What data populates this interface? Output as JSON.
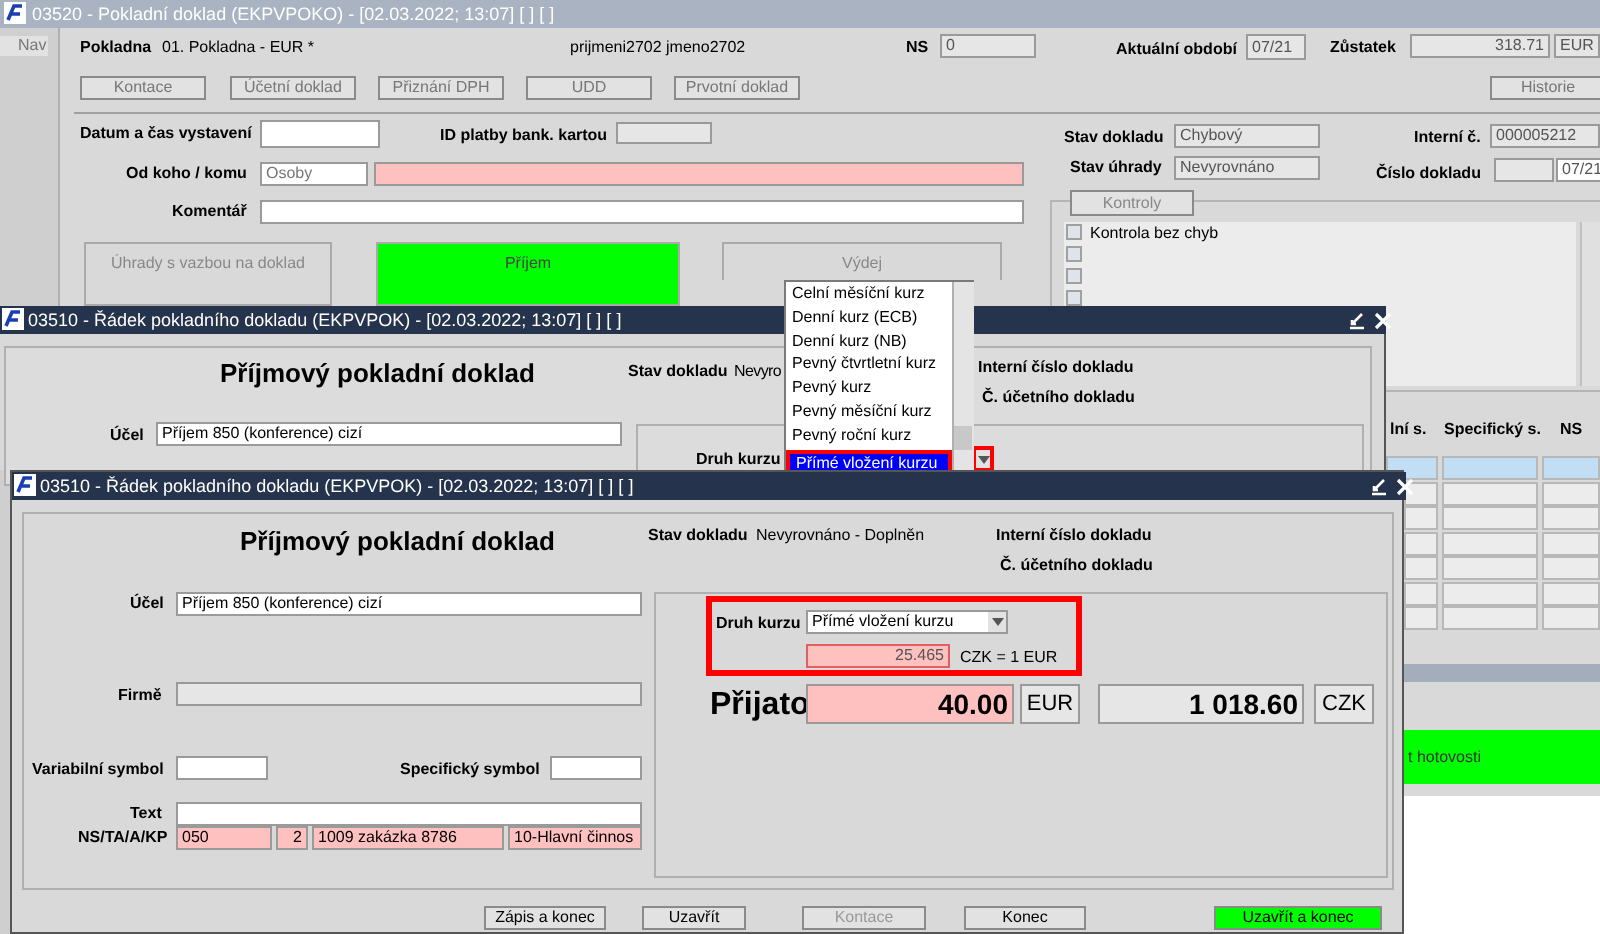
{
  "main_window": {
    "title": "03520 - Pokladní doklad (EKPVPOKO) - [02.03.2022; 13:07] [ ] [ ]",
    "nav": "Nav",
    "cash_desk_label": "Pokladna",
    "cash_desk_value": "01. Pokladna - EUR *",
    "user": "prijmeni2702 jmeno2702",
    "ns_label": "NS",
    "ns_value": "0",
    "period_label": "Aktuální období",
    "period_value": "07/21",
    "balance_label": "Zůstatek",
    "balance_value": "318.71",
    "balance_currency": "EUR",
    "buttons": [
      "Kontace",
      "Účetní doklad",
      "Přiznání DPH",
      "UDD",
      "Prvotní doklad"
    ],
    "history_button": "Historie",
    "issued_label": "Datum a čas vystavení",
    "card_id_label": "ID platby bank. kartou",
    "doc_state_label": "Stav dokladu",
    "doc_state_value": "Chybový",
    "internal_label": "Interní č.",
    "internal_value": "000005212",
    "from_to_label": "Od koho / komu",
    "from_to_type": "Osoby",
    "payment_state_label": "Stav úhrady",
    "payment_state_value": "Nevyrovnáno",
    "doc_number_label": "Číslo dokladu",
    "doc_number_period": "07/21",
    "comment_label": "Komentář",
    "checks_tab": "Kontroly",
    "checks": [
      {
        "label": "Kontrola bez chyb",
        "checked": false
      },
      {
        "checked": false
      },
      {
        "checked": false
      },
      {
        "checked": false
      }
    ],
    "actions": [
      {
        "label": "Úhrady s vazbou na doklad",
        "kind": "plain"
      },
      {
        "label": "Příjem",
        "kind": "green"
      },
      {
        "label": "Výdej",
        "kind": "plain"
      }
    ],
    "table": {
      "columns": [
        "lní s.",
        "Specifický s.",
        "NS"
      ]
    },
    "cash_button": "t hotovosti"
  },
  "middle_window": {
    "title": "03510 - Řádek pokladního dokladu (EKPVPOK) - [02.03.2022; 13:07] [ ] [ ]",
    "heading": "Příjmový pokladní doklad",
    "state_label": "Stav dokladu",
    "state_value": "Nevyro",
    "internal_label": "Interní číslo dokladu",
    "accounting_label": "Č. účetního dokladu",
    "purpose_label": "Účel",
    "purpose_value": "Příjem 850 (konference) cizí",
    "rate_label": "Druh kurzu"
  },
  "rate_dropdown": {
    "items": [
      {
        "label": "Celní měsíční kurz",
        "selected": false
      },
      {
        "label": "Denní kurz (ECB)",
        "selected": false
      },
      {
        "label": "Denní kurz (NB)",
        "selected": false
      },
      {
        "label": "Pevný čtvrtletní kurz",
        "selected": false
      },
      {
        "label": "Pevný kurz",
        "selected": false
      },
      {
        "label": "Pevný měsíční kurz",
        "selected": false
      },
      {
        "label": "Pevný roční kurz",
        "selected": false
      },
      {
        "label": "Přímé vložení kurzu",
        "selected": true
      }
    ]
  },
  "front_window": {
    "title": "03510 - Řádek pokladního dokladu (EKPVPOK) - [02.03.2022; 13:07] [ ] [ ]",
    "heading": "Příjmový pokladní doklad",
    "state_label": "Stav dokladu",
    "state_value": "Nevyrovnáno - Doplněn",
    "internal_label": "Interní číslo dokladu",
    "accounting_label": "Č. účetního dokladu",
    "purpose_label": "Účel",
    "purpose_value": "Příjem 850 (konference) cizí",
    "company_label": "Firmě",
    "variable_label": "Variabilní symbol",
    "specific_label": "Specifický symbol",
    "text_label": "Text",
    "codes_label": "NS/TA/A/KP",
    "codes": [
      "050",
      "2",
      "1009 zakázka 8786",
      "10-Hlavní činnos"
    ],
    "rate_label": "Druh kurzu",
    "rate_value": "Přímé vložení kurzu",
    "rate": "25.465",
    "rate_unit": "CZK = 1 EUR",
    "received_label": "Přijato",
    "amount": "40.00",
    "amount_currency": "EUR",
    "converted": "1 018.60",
    "converted_currency": "CZK",
    "buttons": [
      {
        "label": "Zápis a konec",
        "kind": "normal"
      },
      {
        "label": "Uzavřít",
        "kind": "normal"
      },
      {
        "label": "Kontace",
        "kind": "disabled"
      },
      {
        "label": "Konec",
        "kind": "normal"
      },
      {
        "label": "Uzavřít a konec",
        "kind": "green"
      }
    ]
  }
}
